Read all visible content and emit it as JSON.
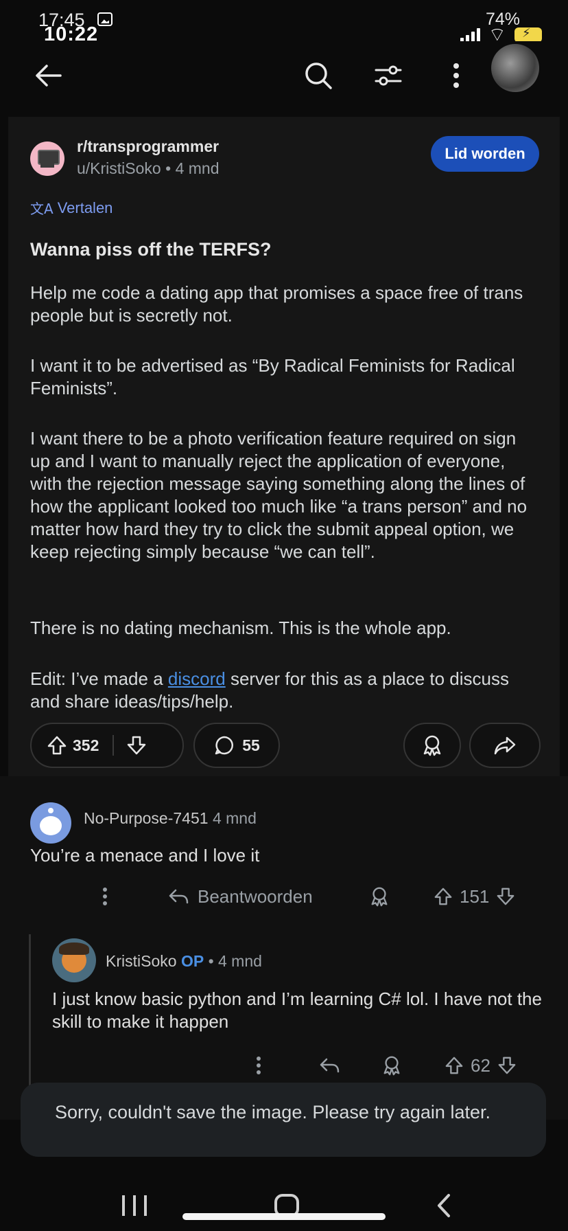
{
  "status_bar": {
    "time_back": "17:45",
    "time_front": "10:22",
    "battery_back": "74%"
  },
  "toolbar": {
    "back_icon": "arrow-left-icon",
    "search_icon": "search-icon",
    "filter_icon": "sort-filter-icon",
    "more_icon": "kebab-icon"
  },
  "post": {
    "subreddit": "r/transprogrammer",
    "author": "u/KristiSoko",
    "age": "4 mnd",
    "join_label": "Lid worden",
    "translate_label": "Vertalen",
    "title": "Wanna piss off the TERFS?",
    "paragraphs": {
      "p1": "Help me code a dating app that promises a space free of trans people but is secretly not.",
      "p2": "I want it to be advertised as “By Radical Feminists for Radical Feminists”.",
      "p3": "I want there to be a photo verification feature required on sign up and I want to manually reject the application of everyone, with the rejection message saying something along the lines of how the applicant looked too much like “a trans person” and no matter how hard they try to click the submit appeal option, we keep rejecting simply because “we can tell”.",
      "p4": "There is no dating mechanism. This is the whole app.",
      "p5_before": "Edit: I’ve made a ",
      "p5_link": "discord",
      "p5_after": " server for this as a place to discuss and share ideas/tips/help."
    },
    "upvotes": "352",
    "comments": "55"
  },
  "comment": {
    "author": "No-Purpose-7451",
    "age": "4 mnd",
    "text": "You’re a menace and I love it",
    "reply_label": "Beantwoorden",
    "score": "151"
  },
  "reply": {
    "author": "KristiSoko",
    "op_badge": "OP",
    "age": "• 4 mnd",
    "text": "I just know basic python and I’m learning C# lol. I have not the skill to make it happen",
    "score": "62"
  },
  "toast": {
    "message": "Sorry, couldn't save the image. Please try again later."
  }
}
